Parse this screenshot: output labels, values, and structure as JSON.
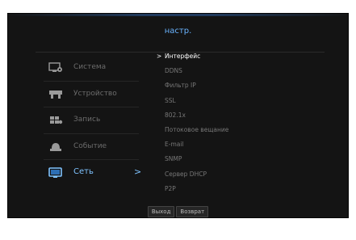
{
  "header": {
    "title": "настр."
  },
  "sidebar": {
    "items": [
      {
        "label": "Система",
        "icon": "monitor-settings-icon",
        "active": false
      },
      {
        "label": "Устройство",
        "icon": "device-icon",
        "active": false
      },
      {
        "label": "Запись",
        "icon": "record-icon",
        "active": false
      },
      {
        "label": "Событие",
        "icon": "event-icon",
        "active": false
      },
      {
        "label": "Сеть",
        "icon": "network-icon",
        "active": true,
        "arrow": ">"
      }
    ]
  },
  "submenu": {
    "caret": ">",
    "items": [
      {
        "label": "Интерфейс",
        "active": true
      },
      {
        "label": "DDNS"
      },
      {
        "label": "Фильтр IP"
      },
      {
        "label": "SSL"
      },
      {
        "label": "802.1x"
      },
      {
        "label": "Потоковое вещание"
      },
      {
        "label": "E-mail"
      },
      {
        "label": "SNMP"
      },
      {
        "label": "Сервер DHCP"
      },
      {
        "label": "P2P"
      }
    ]
  },
  "footer": {
    "exit_label": "Выход",
    "back_label": "Возврат"
  },
  "colors": {
    "accent": "#7fc3ff",
    "panel_bg": "#141414",
    "text_dim": "#6c6c6c"
  }
}
